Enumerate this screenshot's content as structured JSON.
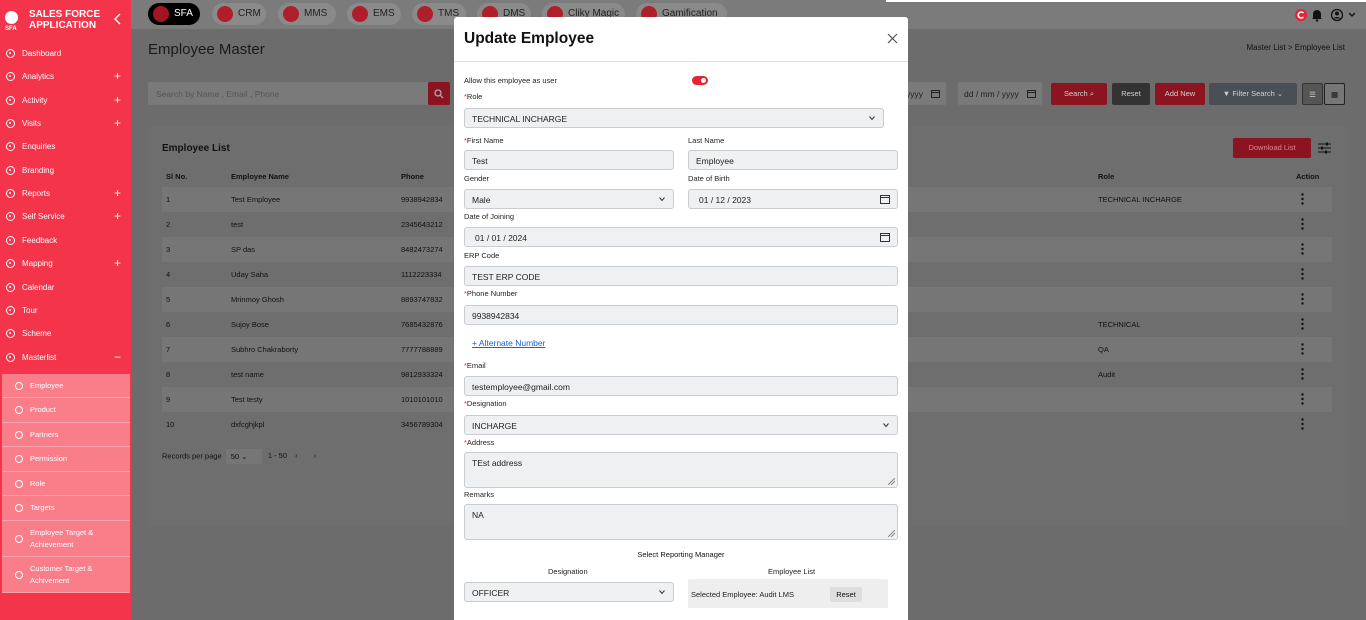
{
  "sidebar": {
    "brand_title": "SALES FORCE APPLICATION",
    "brand_logo_sub": "SFA",
    "items": [
      {
        "label": "Dashboard",
        "expandable": false
      },
      {
        "label": "Analytics",
        "expandable": true
      },
      {
        "label": "Activity",
        "expandable": true
      },
      {
        "label": "Visits",
        "expandable": true
      },
      {
        "label": "Enquiries",
        "expandable": false
      },
      {
        "label": "Branding",
        "expandable": false
      },
      {
        "label": "Reports",
        "expandable": true
      },
      {
        "label": "Self Service",
        "expandable": true
      },
      {
        "label": "Feedback",
        "expandable": false
      },
      {
        "label": "Mapping",
        "expandable": true
      },
      {
        "label": "Calendar",
        "expandable": false
      },
      {
        "label": "Tour",
        "expandable": false
      },
      {
        "label": "Scheme",
        "expandable": false
      },
      {
        "label": "Masterlist",
        "expandable": true,
        "expanded": true
      }
    ],
    "subitems": [
      {
        "label": "Employee"
      },
      {
        "label": "Product"
      },
      {
        "label": "Partners"
      },
      {
        "label": "Permission"
      },
      {
        "label": "Role"
      },
      {
        "label": "Targets"
      },
      {
        "label": "Employee Target & Achievement"
      },
      {
        "label": "Customer Target & Achivement"
      }
    ],
    "expand_symbol": "+",
    "collapse_symbol": "−"
  },
  "apps": [
    {
      "label": "SFA",
      "active": true
    },
    {
      "label": "CRM",
      "active": false
    },
    {
      "label": "MMS",
      "active": false
    },
    {
      "label": "EMS",
      "active": false
    },
    {
      "label": "TMS",
      "active": false
    },
    {
      "label": "DMS",
      "active": false
    },
    {
      "label": "Cliky Magic",
      "active": false
    },
    {
      "label": "Gamification",
      "active": false
    }
  ],
  "page": {
    "title": "Employee Master",
    "breadcrumb": "Master List >  Employee List",
    "search_placeholder": "Search by Name , Email , Phone",
    "date_from_partial": "yyyy",
    "date_to": "dd / mm / yyyy",
    "search_btn": "Search",
    "reset_btn": "Reset",
    "add_btn": "Add New",
    "filter_btn": "Filter Search"
  },
  "table": {
    "title": "Employee List",
    "download_btn": "Download List",
    "headers": {
      "sl": "Sl No.",
      "name": "Employee Name",
      "phone": "Phone",
      "role": "Role",
      "action": "Action"
    },
    "rows": [
      {
        "sl": "1",
        "name": "Test Employee",
        "phone": "9938942834",
        "role": "TECHNICAL INCHARGE"
      },
      {
        "sl": "2",
        "name": "test",
        "phone": "2345643212",
        "role": ""
      },
      {
        "sl": "3",
        "name": "SP das",
        "phone": "8482473274",
        "role": ""
      },
      {
        "sl": "4",
        "name": "Uday Saha",
        "phone": "1112223334",
        "role": ""
      },
      {
        "sl": "5",
        "name": "Mrinmoy Ghosh",
        "phone": "8893747832",
        "role": ""
      },
      {
        "sl": "6",
        "name": "Sujoy Bose",
        "phone": "7685432876",
        "role": "TECHNICAL"
      },
      {
        "sl": "7",
        "name": "Subhro Chakraborty",
        "phone": "7777788889",
        "role": "QA"
      },
      {
        "sl": "8",
        "name": "test name",
        "phone": "9812933324",
        "role": "Audit"
      },
      {
        "sl": "9",
        "name": "Test testy",
        "phone": "1010101010",
        "role": ""
      },
      {
        "sl": "10",
        "name": "dxfcghjkpl",
        "phone": "3456789304",
        "role": ""
      }
    ],
    "records_per_page_label": "Records per page",
    "records_per_page": "50",
    "range": "1 - 50"
  },
  "modal": {
    "title": "Update Employee",
    "allow_user_label": "Allow this employee as user",
    "allow_user": true,
    "role_label": "Role",
    "role_value": "TECHNICAL INCHARGE",
    "first_name_label": "First Name",
    "first_name": "Test",
    "last_name_label": "Last Name",
    "last_name": "Employee",
    "gender_label": "Gender",
    "gender": "Male",
    "dob_label": "Date of Birth",
    "dob": "01 / 12 / 2023",
    "doj_label": "Date of Joining",
    "doj": "01 / 01 / 2024",
    "erp_label": "ERP Code",
    "erp": "TEST ERP CODE",
    "phone_label": "Phone Number",
    "phone": "9938942834",
    "alt_number_link": "+ Alternate Number",
    "email_label": "Email",
    "email": "testemployee@gmail.com",
    "designation_label": "Designation",
    "designation": "INCHARGE",
    "address_label": "Address",
    "address": "TEst address",
    "remarks_label": "Remarks",
    "remarks": "NA",
    "reporting_title": "Select Reporting Manager",
    "rm_designation_label": "Designation",
    "rm_designation": "OFFICER",
    "rm_employee_label": "Employee List",
    "rm_selected": "Selected Employee: Audit LMS",
    "rm_reset": "Reset",
    "required_mark": "*"
  },
  "colors": {
    "brand_red": "#f3344a",
    "overlay_grey": "#7b7b7b"
  }
}
